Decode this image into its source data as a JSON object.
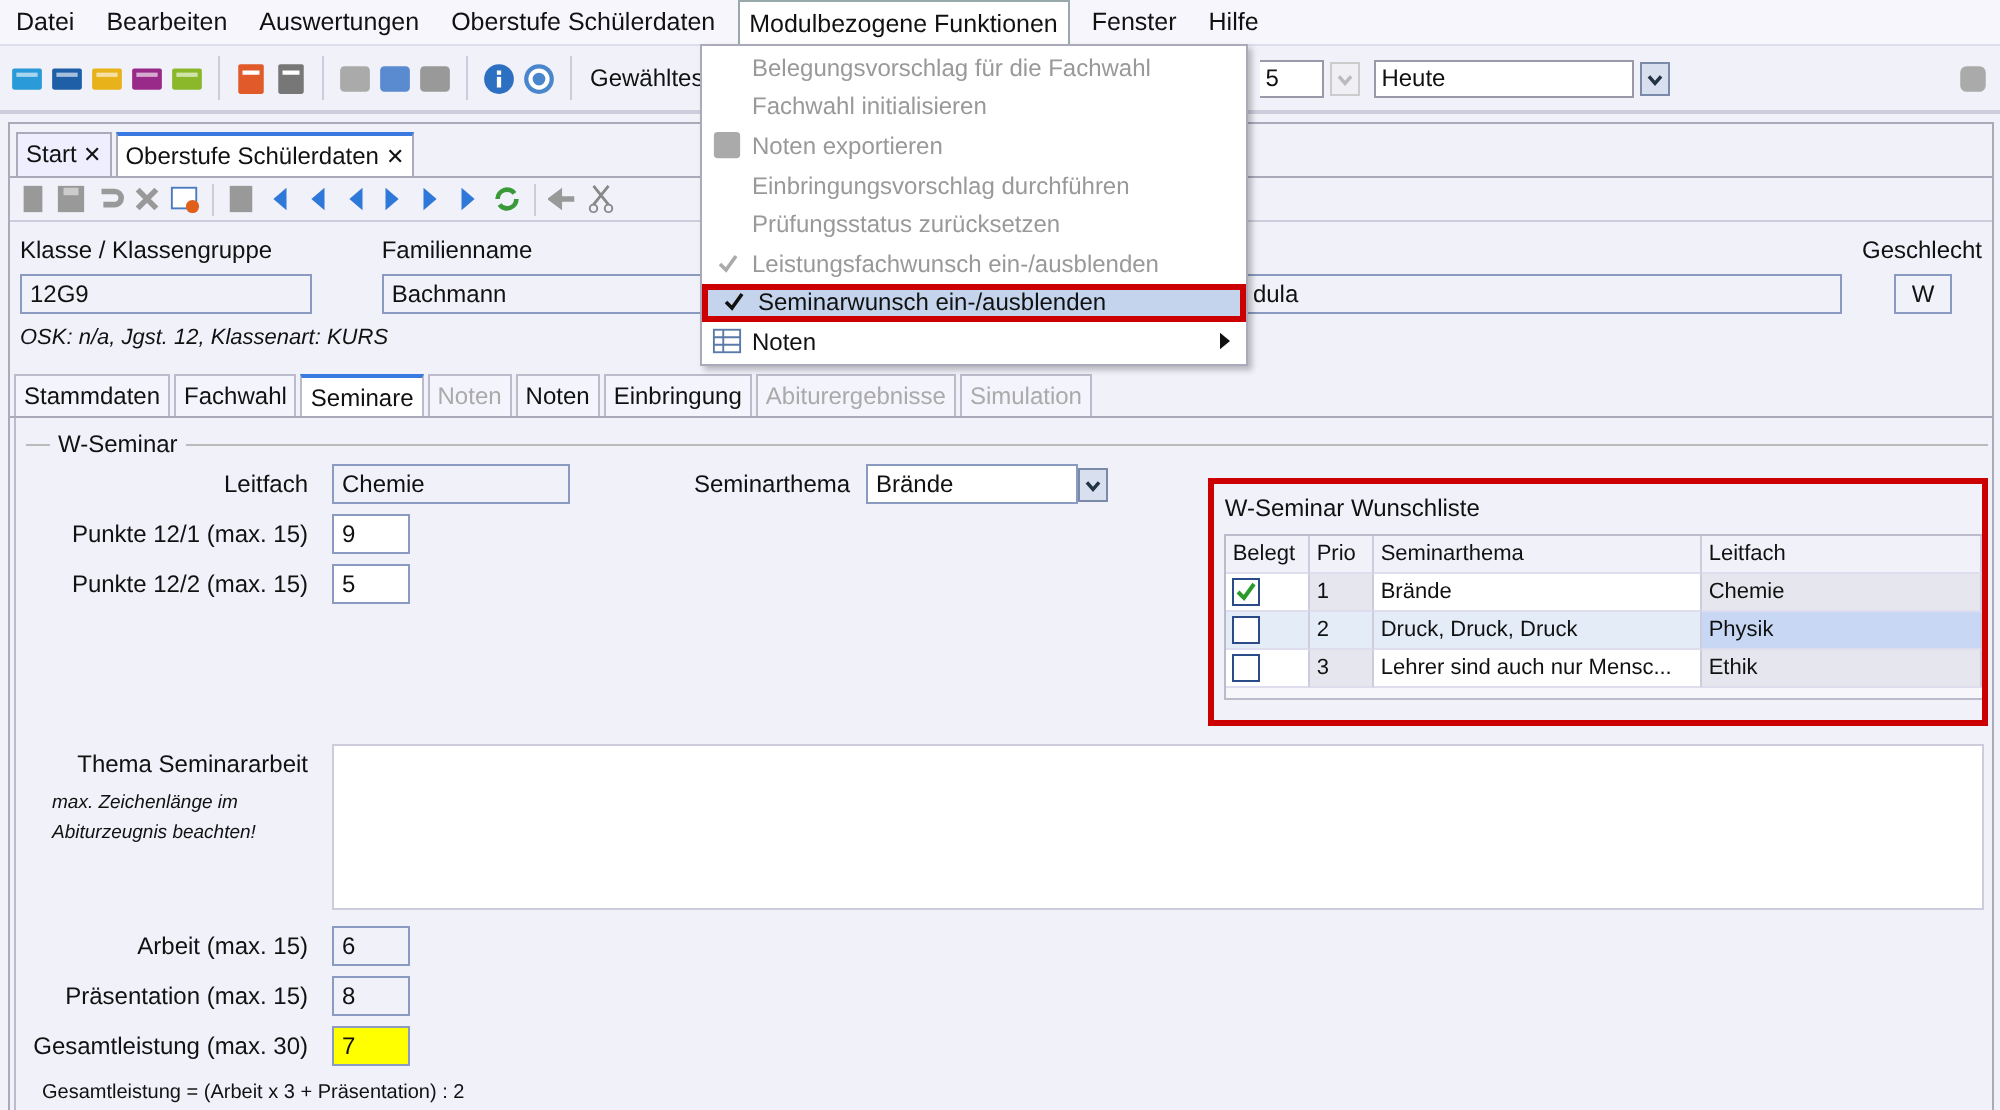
{
  "menu_bar": [
    {
      "label": "Datei",
      "selected": false
    },
    {
      "label": "Bearbeiten",
      "selected": false
    },
    {
      "label": "Auswertungen",
      "selected": false
    },
    {
      "label": "Oberstufe Schülerdaten",
      "selected": false
    },
    {
      "label": "Modulbezogene Funktionen",
      "selected": true
    },
    {
      "label": "Fenster",
      "selected": false
    },
    {
      "label": "Hilfe",
      "selected": false
    }
  ],
  "toolbar": {
    "label": "Gewähltes",
    "combo_1": "5",
    "combo_2": "Heute"
  },
  "document_tabs": [
    {
      "label": "Start",
      "selected": false,
      "close": "✕"
    },
    {
      "label": "Oberstufe Schülerdaten",
      "selected": true,
      "close": "✕"
    }
  ],
  "header": {
    "class_label": "Klasse / Klassengruppe",
    "class_value": "12G9",
    "surname_label": "Familienname",
    "surname_value": "Bachmann",
    "first_name_value": "dula",
    "gender_label": "Geschlecht",
    "gender_value": "W",
    "info": "OSK: n/a, Jgst. 12, Klassenart: KURS"
  },
  "tabs": [
    {
      "label": "Stammdaten",
      "selected": false,
      "disabled": false
    },
    {
      "label": "Fachwahl",
      "selected": false,
      "disabled": false
    },
    {
      "label": "Seminare",
      "selected": true,
      "disabled": false
    },
    {
      "label": "Noten",
      "selected": false,
      "disabled": true
    },
    {
      "label": "Noten",
      "selected": false,
      "disabled": false
    },
    {
      "label": "Einbringung",
      "selected": false,
      "disabled": false
    },
    {
      "label": "Abiturergebnisse",
      "selected": false,
      "disabled": true
    },
    {
      "label": "Simulation",
      "selected": false,
      "disabled": true
    }
  ],
  "seminar": {
    "legend": "W-Seminar",
    "leitfach_label": "Leitfach",
    "leitfach_value": "Chemie",
    "thema_label": "Seminarthema",
    "thema_value": "Brände",
    "points": [
      {
        "label": "Punkte 12/1 (max. 15)",
        "value": "9",
        "readonly": false,
        "highlighted": false
      },
      {
        "label": "Punkte 12/2 (max. 15)",
        "value": "5",
        "readonly": false,
        "highlighted": false
      }
    ],
    "paper_label": "Thema Seminararbeit",
    "paper_hint": "max. Zeichenlänge im Abiturzeugnis beachten!",
    "grades": [
      {
        "label": "Arbeit (max. 15)",
        "value": "6",
        "readonly": true,
        "highlighted": false
      },
      {
        "label": "Präsentation (max. 15)",
        "value": "8",
        "readonly": true,
        "highlighted": false
      },
      {
        "label": "Gesamtleistung (max. 30)",
        "value": "7",
        "readonly": true,
        "highlighted": true
      }
    ],
    "formula": "Gesamtleistung = (Arbeit x 3 + Präsentation) : 2"
  },
  "wishlist": {
    "title": "W-Seminar Wunschliste",
    "columns": [
      "Belegt",
      "Prio",
      "Seminarthema",
      "Leitfach"
    ],
    "rows": [
      {
        "checked": true,
        "prio": "1",
        "thema": "Brände",
        "leitfach": "Chemie",
        "selected": false
      },
      {
        "checked": false,
        "prio": "2",
        "thema": "Druck, Druck, Druck",
        "leitfach": "Physik",
        "selected": true
      },
      {
        "checked": false,
        "prio": "3",
        "thema": "Lehrer sind auch nur Mensc...",
        "leitfach": "Ethik",
        "selected": false
      }
    ]
  },
  "dropdown_menu": [
    {
      "label": "Belegungsvorschlag für die Fachwahl",
      "kind": "action",
      "disabled": true,
      "checked": false,
      "selected": false
    },
    {
      "label": "Fachwahl initialisieren",
      "kind": "action",
      "disabled": true,
      "checked": false,
      "selected": false
    },
    {
      "label": "Noten exportieren",
      "kind": "action_icon",
      "disabled": true,
      "checked": false,
      "selected": false
    },
    {
      "label": "Einbringungsvorschlag durchführen",
      "kind": "action",
      "disabled": true,
      "checked": false,
      "selected": false
    },
    {
      "label": "Prüfungsstatus zurücksetzen",
      "kind": "action",
      "disabled": true,
      "checked": false,
      "selected": false
    },
    {
      "label": "Leistungsfachwunsch ein-/ausblenden",
      "kind": "action",
      "disabled": true,
      "checked": true,
      "selected": false
    },
    {
      "label": "Seminarwunsch ein-/ausblenden",
      "kind": "action",
      "disabled": false,
      "checked": true,
      "selected": true
    },
    {
      "label": "Noten",
      "kind": "submenu",
      "disabled": false,
      "checked": false,
      "selected": false
    }
  ]
}
